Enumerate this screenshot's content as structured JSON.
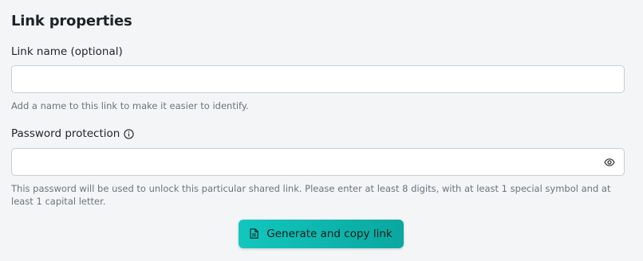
{
  "section": {
    "title": "Link properties"
  },
  "link_name": {
    "label": "Link name (optional)",
    "value": "",
    "placeholder": "",
    "helper": "Add a name to this link to make it easier to identify."
  },
  "password": {
    "label": "Password protection",
    "value": "",
    "placeholder": "",
    "helper": "This password will be used to unlock this particular shared link. Please enter at least 8 digits, with at least 1 special symbol and at least 1 capital letter.",
    "info_icon": "info-icon",
    "toggle_icon": "eye-icon"
  },
  "actions": {
    "generate_label": "Generate and copy link",
    "generate_icon": "document-icon"
  },
  "colors": {
    "background": "#f4f5f7",
    "accent_start": "#12c7be",
    "accent_end": "#0aa79f"
  }
}
